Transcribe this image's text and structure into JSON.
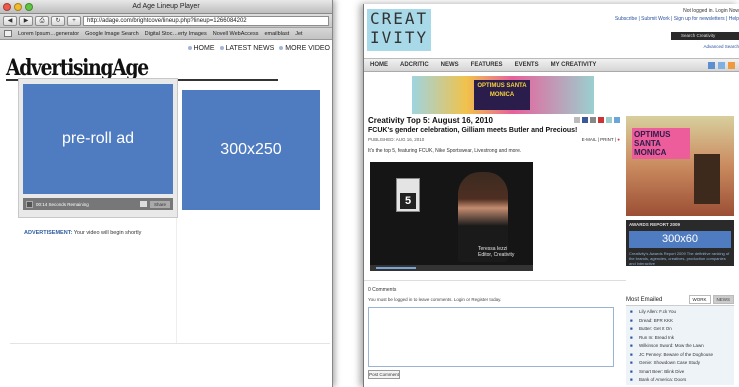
{
  "left_window": {
    "title": "Ad Age Lineup Player",
    "url": "http://adage.com/brightcove/lineup.php?lineup=1266084202",
    "bookmarks": [
      "Lorem Ipsum…generator",
      "Google Image Search",
      "Digital Stoc…erty Images",
      "Novell WebAccess",
      "emailblast",
      "Jet"
    ],
    "nav": [
      "HOME",
      "LATEST NEWS",
      "MORE VIDEO"
    ],
    "logo": "AdvertisingAge",
    "preroll_label": "pre-roll ad",
    "player_status": "00:14 Seconds Remaining",
    "share_label": "Share",
    "box_label": "300x250",
    "advert_label": "ADVERTISEMENT:",
    "advert_text": "Your video will begin shortly"
  },
  "right_window": {
    "logo_line1": "CREAT",
    "logo_line2": "IVITY",
    "not_logged": "Not logged in. Login Now",
    "links": "Subscribe | Submit Work | Sign up for newsletters | Help",
    "search_placeholder": "Search Creativity",
    "advanced": "Advanced Search",
    "nav": [
      "HOME",
      "ADCRITIC",
      "NEWS",
      "FEATURES",
      "EVENTS",
      "MY CREATIVITY"
    ],
    "banner_text": "OPTIMUS SANTA MONICA",
    "title": "Creativity Top 5: August 16, 2010",
    "subtitle": "FCUK's gender celebration, Gilliam meets Butler and Precious!",
    "published": "PUBLISHED: AUG 16, 2010",
    "email_print": "E-MAIL | PRINT |",
    "description": "It's the top 5, featuring FCUK, Nike Sportswear, Livestrong and more.",
    "video_card_text": "5",
    "video_caption_1": "Teressa Iezzi",
    "video_caption_2": "Editor, Creativity",
    "comments_head": "0 Comments",
    "comments_note": "You must be logged in to leave comments. Login or Register today.",
    "post_button": "Post Comment",
    "side_image_text": "OPTIMUS SANTA MONICA",
    "awards_label": "AWARDS REPORT 2009",
    "box_300x60": "300x60",
    "awards_desc": "Creativity's Awards Report 2009 The definitive ranking of the brands, agencies, creatives, production companies and interactive",
    "most_emailed": "Most Emailed",
    "tab_work": "WORK",
    "tab_news": "NEWS",
    "emailed_items": [
      "Lily Allen: F.ck You",
      "Dread: BFR KKK",
      "Butter: Get It On",
      "Run In: Bread Ink",
      "Wilkinson Sword: Mow the Lawn",
      "JC Penney: Beware of the Doghouse",
      "Genie: Showdown Case Study",
      "Smart Beer: Blink Dive",
      "Bank of America: Doors"
    ]
  },
  "colors": {
    "ad_blue": "#4f7cc0",
    "creativity_logo_bg": "#a8d9e8",
    "link_blue": "#2a52a0"
  }
}
